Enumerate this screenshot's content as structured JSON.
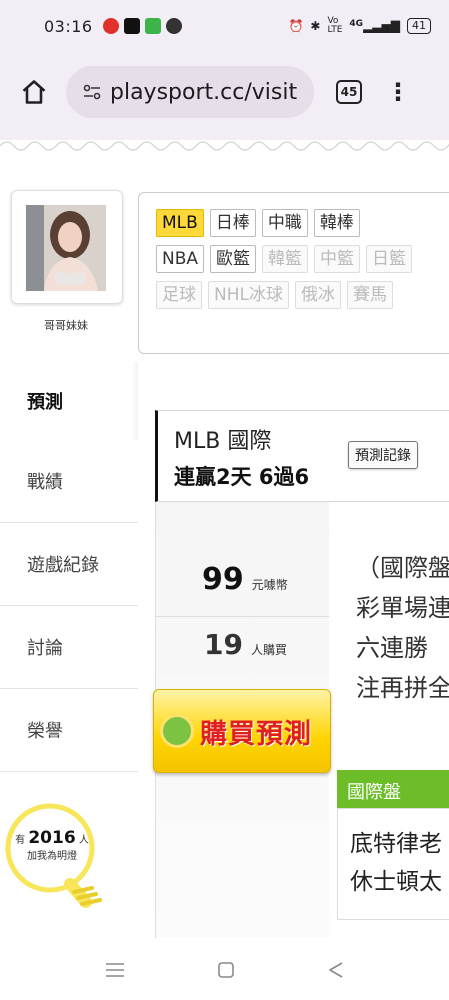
{
  "status_bar": {
    "time": "03:16",
    "notification_icons": [
      "notification-icon",
      "youtube-icon",
      "app-icon",
      "line-icon"
    ],
    "right_icons": [
      "alarm-icon",
      "bluetooth-icon",
      "volte-icon",
      "signal-icon"
    ],
    "network": "4G",
    "battery": "41"
  },
  "browser": {
    "url": "playsport.cc/visit",
    "tab_count": "45"
  },
  "profile": {
    "username": "哥哥妹妹"
  },
  "sidebar": {
    "items": [
      {
        "label": "預測",
        "active": true
      },
      {
        "label": "戰績"
      },
      {
        "label": "遊戲紀錄"
      },
      {
        "label": "討論"
      },
      {
        "label": "榮譽"
      }
    ],
    "lamp": {
      "prefix": "有",
      "count": "2016",
      "suffix": "人",
      "line2": "加我為明燈"
    }
  },
  "leagues": {
    "row1": [
      "MLB",
      "日棒",
      "中職",
      "韓棒"
    ],
    "row2": [
      "NBA",
      "歐籃",
      "韓籃",
      "中籃",
      "日籃"
    ],
    "row3": [
      "足球",
      "NHL冰球",
      "俄冰",
      "賽馬"
    ],
    "active": "MLB",
    "disabled": [
      "韓籃",
      "中籃",
      "日籃",
      "足球",
      "NHL冰球",
      "俄冰",
      "賽馬"
    ]
  },
  "prediction": {
    "league": "MLB 國際",
    "streak": "連贏2天 6過6",
    "record_button": "預測記錄",
    "price": "99",
    "price_unit": "元噱幣",
    "buyers": "19",
    "buyers_unit": "人購買",
    "buy_button": "購買預測",
    "description_lines": [
      "（國際盤",
      "彩單場連",
      "六連勝",
      "注再拼全"
    ],
    "pick_tag": "國際盤",
    "pick_lines": [
      "底特律老",
      "休士頓太"
    ]
  },
  "colors": {
    "chrome_bg": "#f3eef6",
    "chip_active": "#ffd83a",
    "buy_button": "#ffd400",
    "buy_text": "#e0201e",
    "pick_tag": "#6cbd27"
  }
}
